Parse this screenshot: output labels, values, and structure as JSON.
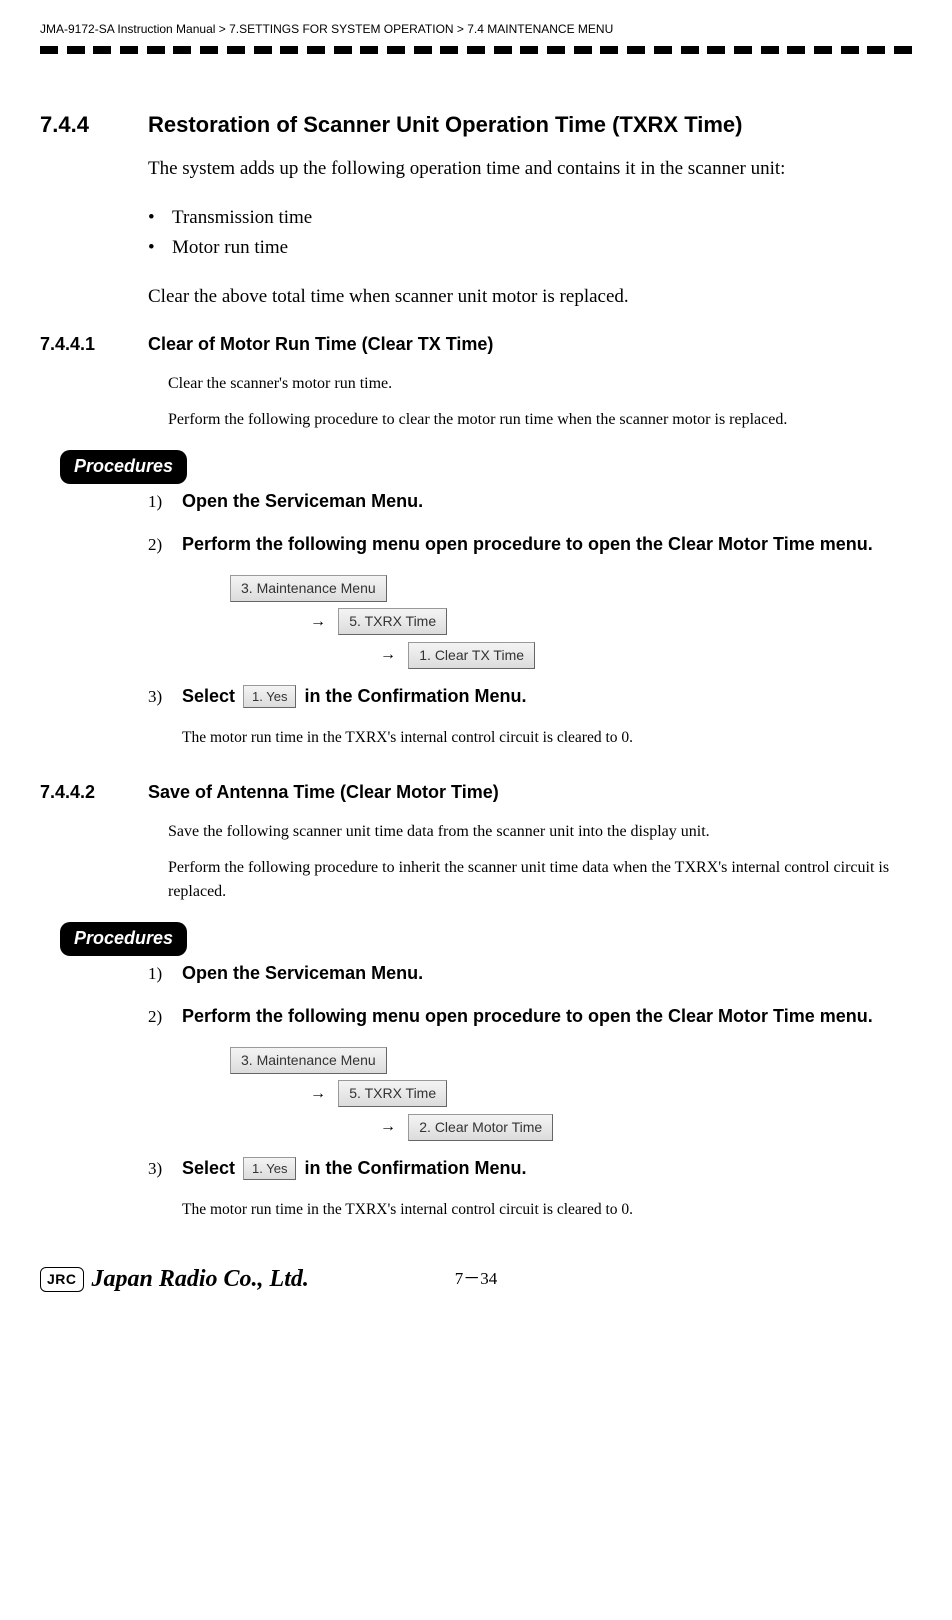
{
  "header": {
    "path": "JMA-9172-SA Instruction Manual > 7.SETTINGS FOR SYSTEM OPERATION > 7.4  MAINTENANCE MENU"
  },
  "section": {
    "num": "7.4.4",
    "title": "Restoration of Scanner Unit Operation Time  (TXRX Time)",
    "intro": "The system adds up the following operation time and contains it in the scanner unit:",
    "bullets": [
      "Transmission time",
      "Motor run time"
    ],
    "after_bullets": "Clear the above total time when scanner unit motor is replaced."
  },
  "sub1": {
    "num": "7.4.4.1",
    "title": "Clear of Motor Run Time (Clear TX Time)",
    "p1": "Clear the scanner's motor run time.",
    "p2": "Perform the following procedure to clear the motor run time when the scanner motor is replaced.",
    "procedures_label": "Procedures",
    "step1": {
      "n": "1)",
      "text": "Open the Serviceman Menu."
    },
    "step2": {
      "n": "2)",
      "text": "Perform the following menu open procedure to open the Clear Motor Time menu."
    },
    "menu1": "3. Maintenance Menu",
    "menu2": "5. TXRX Time",
    "menu3": "1. Clear TX Time",
    "step3": {
      "n": "3)",
      "pre": "Select",
      "btn": "1. Yes",
      "post": " in the Confirmation Menu."
    },
    "note": "The motor run time in the TXRX's internal control circuit is cleared to 0."
  },
  "sub2": {
    "num": "7.4.4.2",
    "title": "Save of Antenna Time  (Clear Motor Time)",
    "p1": "Save the following scanner unit time data from the scanner unit into the display unit.",
    "p2": "Perform the following procedure to inherit the scanner unit time data when the TXRX's internal control circuit is replaced.",
    "procedures_label": "Procedures",
    "step1": {
      "n": "1)",
      "text": "Open the Serviceman Menu."
    },
    "step2": {
      "n": "2)",
      "text": "Perform the following menu open procedure to open the Clear Motor Time menu."
    },
    "menu1": "3. Maintenance Menu",
    "menu2": "5. TXRX Time",
    "menu3": "2. Clear Motor Time",
    "step3": {
      "n": "3)",
      "pre": "Select",
      "btn": "1. Yes",
      "post": " in the Confirmation Menu."
    },
    "note": "The motor run time in the TXRX's internal control circuit is cleared to 0."
  },
  "footer": {
    "jrc": "JRC",
    "company": "Japan Radio Co., Ltd.",
    "page": "7－34"
  },
  "arrow": "→"
}
